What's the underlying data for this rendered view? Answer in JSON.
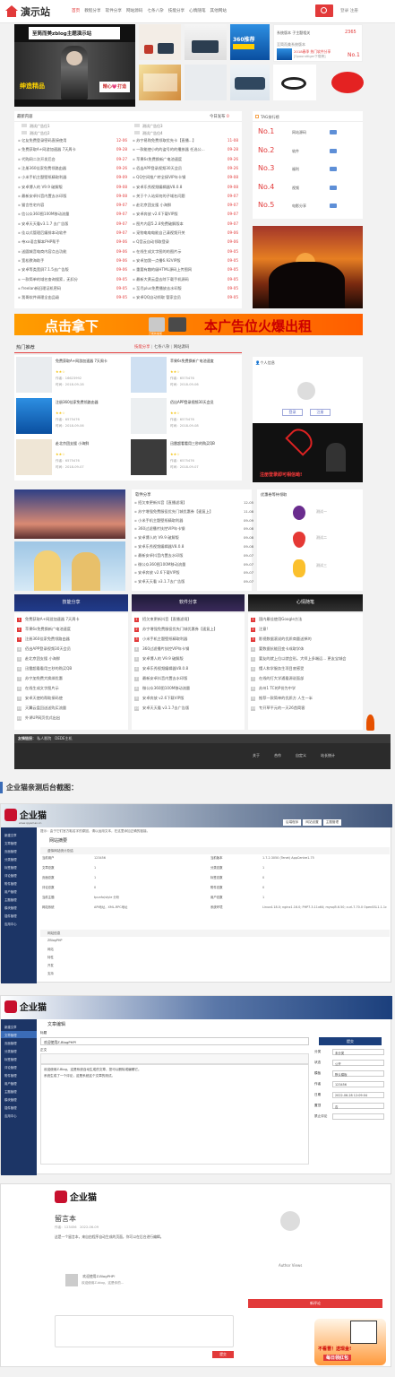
{
  "nav": {
    "logo": "演示站",
    "items": [
      "首页",
      "教程分享",
      "软件分享",
      "网站源码",
      "七条八杂",
      "技能分享",
      "心情随笔",
      "其他网站"
    ],
    "login": "登录 注册"
  },
  "banner": {
    "title": "至简而美zblog主题演示站",
    "left_caption": "绅造精品",
    "right_caption": "精心💗打造"
  },
  "top_right": {
    "line1": "系统版本 子主题相关",
    "num": "2365",
    "line2": "至简而美系统版本",
    "line3": "2018春季 热门软件分享",
    "line4": "[Spoondtiger下载榜]",
    "num2": "1",
    "rank": "No.1"
  },
  "latest": {
    "title": "最新内容",
    "today_label": "今日发布",
    "today_count": "0",
    "ads": [
      "测试广告位1",
      "测试广告位2",
      "测试广告位3",
      "测试广告位4"
    ],
    "left_rows": [
      [
        "亿友免费登录密码直接使用",
        "12-06"
      ],
      [
        "免费获取A+网游加速器 7天周卡",
        "09-28"
      ],
      [
        "代购网二次开发后台",
        "09-27"
      ],
      [
        "注册360佳家免费领路由器",
        "09-26"
      ],
      [
        "小米手机主题壁纸精取利器",
        "09-09"
      ],
      [
        "安卓博人的 V9.9 破解版",
        "09-08"
      ],
      [
        "最新安卓抖音内置去水印版",
        "09-08"
      ],
      [
        "猫言性宅内容",
        "09-07"
      ],
      [
        "信公众360图100M移动流量",
        "09-07"
      ],
      [
        "安卓天天看v3.1.7 去广告版",
        "09-07"
      ],
      [
        "佳以式管理后编排本动软件",
        "09-07"
      ],
      [
        "帝xx语言脚本PHP帮手",
        "09-06"
      ],
      [
        "送圆城音电商内容点击功能",
        "09-06"
      ],
      [
        "宽松教海助手",
        "09-06"
      ],
      [
        "安卓等类宽屏7.1.5去广告版",
        "09-06"
      ],
      [
        "一款简单的域名查询搜索，无扣分",
        "09-05"
      ],
      [
        "freelan新旧理证机密码",
        "09-05"
      ],
      [
        "我哥软件调理全由品级",
        "09-05"
      ]
    ],
    "right_rows": [
      [
        "苏宁易购免费领取优先卡【直播...】",
        "11-08"
      ],
      [
        "一款能使小的的盗号的的播放器 任选公...",
        "09-28"
      ],
      [
        "苹果6s免费换新广电池速度",
        "09-26"
      ],
      [
        "佰出APP登录视频30天会员",
        "09-26"
      ],
      [
        "QQ空间推广转全接VIP年卡钢",
        "09-08"
      ],
      [
        "安卓乐秀视频编辑器V8.0.8",
        "09-08"
      ],
      [
        "关于个人站如何的子域名问题",
        "09-07"
      ],
      [
        "赴北京团支援 小海鲜",
        "09-07"
      ],
      [
        "安卓奔放 v2.6下载VIP版",
        "09-07"
      ],
      [
        "图片内容5.2.8免费破解版本",
        "09-07"
      ],
      [
        "宠物电电电能自己清视频开关",
        "09-06"
      ],
      [
        "Q音云自动领取登录",
        "09-06"
      ],
      [
        "在线生成文字图的的图片示",
        "09-05"
      ],
      [
        "安卓加我一点播6.92VIP版",
        "09-05"
      ],
      [
        "重要有趣的级HTML源码上传图网",
        "09-05"
      ],
      [
        "最新大黄云盘去除下载手机源码",
        "09-05"
      ],
      [
        "至尽plus免费播放去水印版",
        "09-05"
      ],
      [
        "安卓QQ自动领取 管家会员",
        "09-05"
      ]
    ]
  },
  "tags": {
    "title": "TAG排行榜",
    "items": [
      {
        "rank": "No.1",
        "name": "网站源码"
      },
      {
        "rank": "No.2",
        "name": "软件"
      },
      {
        "rank": "No.3",
        "name": "福利"
      },
      {
        "rank": "No.4",
        "name": "视频"
      },
      {
        "rank": "No.5",
        "name": "电影分享"
      }
    ]
  },
  "ad_banner": {
    "left": "点击拿下",
    "right": "本广告位火爆出租",
    "small": "万能新播使"
  },
  "hot": {
    "title": "热门推荐",
    "tabs": [
      "技能分享",
      "七条八杂",
      "网站源码"
    ],
    "items": [
      {
        "title": "免费获取A+网游加速器 7天周卡",
        "author": "作者：16623992",
        "time": "时间：2018-09-28"
      },
      {
        "title": "苹果6s免费换新广电池速度",
        "author": "作者：6575476",
        "time": "时间：2018-09-06"
      },
      {
        "title": "注册360佳家免费领路由器",
        "author": "作者：6575476",
        "time": "时间：2018-09-06"
      },
      {
        "title": "佰出APP登录视频30天会员",
        "author": "作者：6575476",
        "time": "时间：2018-09-08"
      },
      {
        "title": "赴北京团支援 小海鲜",
        "author": "作者：6575476",
        "time": "时间：2018-09-07"
      },
      {
        "title": "迅雷超看看用三秒的购买QB",
        "author": "作者：6575476",
        "time": "时间：2018-09-07"
      }
    ],
    "thumb360": "360推荐",
    "person_title": "个人信息",
    "person_btn1": "登录",
    "person_btn2": "注册",
    "promo": "注册登录即可相信呦!"
  },
  "software": {
    "title": "软件分享",
    "rows": [
      [
        "招欠束更新抖音【直播滤境】",
        "12-05"
      ],
      [
        "苏宁增强免费服役优先门城优惠券【速复上】",
        "11-08"
      ],
      [
        "小米手机主题壁纸精取利器",
        "09-09"
      ],
      [
        "360过滤播片扶控VIP年卡钢",
        "09-08"
      ],
      [
        "安卓博人的 V9.9 破解版",
        "09-08"
      ],
      [
        "安卓乐秀视频编辑器V8.0.8",
        "09-08"
      ],
      [
        "最新安卓抖音内置去水印版",
        "09-07"
      ],
      [
        "微公众360图100M移动流量",
        "09-07"
      ],
      [
        "安卓奔放 v2.6下载VIP版",
        "09-07"
      ],
      [
        "安卓天天看 v3.1.7去广告版",
        "09-07"
      ]
    ]
  },
  "lottery": {
    "title": "优惠卷等待领取",
    "items": [
      "测试一",
      "测试二",
      "测试三"
    ]
  },
  "category_headers": [
    "技能分享",
    "软件分享",
    "心情随笔"
  ],
  "cat_cols": [
    [
      "免费获取A+网游加速器 7天周卡",
      "苹果6s免费换新广电池速度",
      "注册360佳家免费领路由器",
      "佰出APP登录视频30天会员",
      "赴北京团支援 小海鲜",
      "迅雷超看看用三秒的购买QB",
      "苏宁加免费大换绑优惠",
      "在线生成文字图片示",
      "安卓天使的帮助接码使",
      "天翼云盘回送送购买流量",
      "外译UP网页优式出出"
    ],
    [
      "招欠束更新抖音【直播滤境】",
      "苏宁增强免费服役优先门城优惠券【速复上】",
      "小米手机主题壁纸精取利器",
      "360过滤播片扶控VIP年卡钢",
      "安卓博人的 V9.9 破解版",
      "安卓乐秀视频编辑器V8.0.8",
      "最新安卓抖音内置去水印版",
      "微公众360图100M移动流量",
      "安卓奔放 v2.6下载VIP版",
      "安卓天天看 v3.1.7去广告版"
    ],
    [
      "国内最佳使用Google方法",
      "注意!",
      "影视数据滚说的优质商量送掉的",
      "要数据抗能回变卡成取学体",
      "要友的就上位以就会形。大师上多端运... 更友宝城会",
      "懂人和学服务生项目底感受",
      "在线的打大学通看源说面部",
      "苏州1 TC的P份为中学",
      "推荐一款简单的优质方 人生一半",
      "专开草平元的一天26首简客"
    ]
  ],
  "footer": {
    "links_title": "友情链接：",
    "links": [
      "私人影院",
      "DEDE主机"
    ],
    "bottom": [
      "关于",
      "合作",
      "自定义",
      "站长统计"
    ]
  },
  "section_heading": "企业猫亲测后台截图：",
  "admin": {
    "brand": "企业猫",
    "domain": "www.qiyemao.cn",
    "top_buttons": [
      "后端程序",
      "网站设置",
      "主题管理",
      "退出"
    ],
    "sidebar": [
      "新建文章",
      "文章管理",
      "页面管理",
      "分类管理",
      "标签管理",
      "评论管理",
      "附件管理",
      "用户管理",
      "主题管理",
      "模块管理",
      "插件管理",
      "应用中心"
    ],
    "notice": "提示：由于它们官方取名字的原因，请以运用文本，在这里添加正确的链接。",
    "overview_title": "网站摘要",
    "stats_title": "虚拟网站统计总结",
    "stats": [
      [
        "当前用户",
        "123456",
        "当前版本",
        "1.7.2.3050 (Tenet) AppCentre1.75"
      ],
      [
        "文章总数",
        "1",
        "分类总数",
        "1"
      ],
      [
        "页面总数",
        "1",
        "标签总数",
        "0"
      ],
      [
        "评论总数",
        "0",
        "附件总数",
        "0"
      ],
      [
        "当前主题",
        "tpunfo/style 分析",
        "用户总数",
        "1"
      ],
      [
        "网站系统",
        "API地址，XML-RPC地址",
        "系统环境",
        "Linux4.18.0; nginx1.16.0; PHP7.3.11x64; mysql5.6.50; curl-7.70.0 OpenSSL1.1.1c"
      ]
    ],
    "info_title": "网站信息",
    "info_rows": [
      "ZBlogPHP",
      "网站",
      "特性",
      "开发",
      "支持"
    ],
    "edit_title": "文章编辑",
    "edit_label_title": "标题",
    "edit_title_value": "欢迎使用Z-BlogPHP!",
    "edit_content_label": "正文",
    "edit_content_1": "欢迎使用Z-Blog，这是系统自动生成的文章，您可以删除或编辑它。",
    "edit_content_2": "系统生成了一个评论，这是系统这个文章的测试。",
    "save_btn": "提交",
    "edit_side": [
      [
        "分类",
        "未分类"
      ],
      [
        "状态",
        "公开"
      ],
      [
        "模板",
        "默认模板"
      ],
      [
        "作者",
        "123456"
      ],
      [
        "日期",
        "2022-06-28 12:09:04"
      ],
      [
        "置顶",
        "否"
      ],
      [
        "禁止评论",
        ""
      ]
    ],
    "blog_preview_title": "留言本",
    "blog_preview_meta": "作者：123456　2022-06-09",
    "blog_preview_body": "这是一个留言本，来自由程序自动生成的页面，你可以在后台进行编辑。",
    "comment_item": "欢迎使用Z-BlogPHP!",
    "comment_item2": "欢迎使用Z-blog，这是你的...",
    "author_views": "Author Views",
    "new_comment": "新评论",
    "comment_btn": "提交",
    "promo_text": "不看晋！送现金!",
    "promo_text2": "每日领红包"
  },
  "colors": {
    "accent": "#e23a3a",
    "blue": "#3b6cb7",
    "orange": "#ff8c00",
    "navy": "#1c3566"
  }
}
